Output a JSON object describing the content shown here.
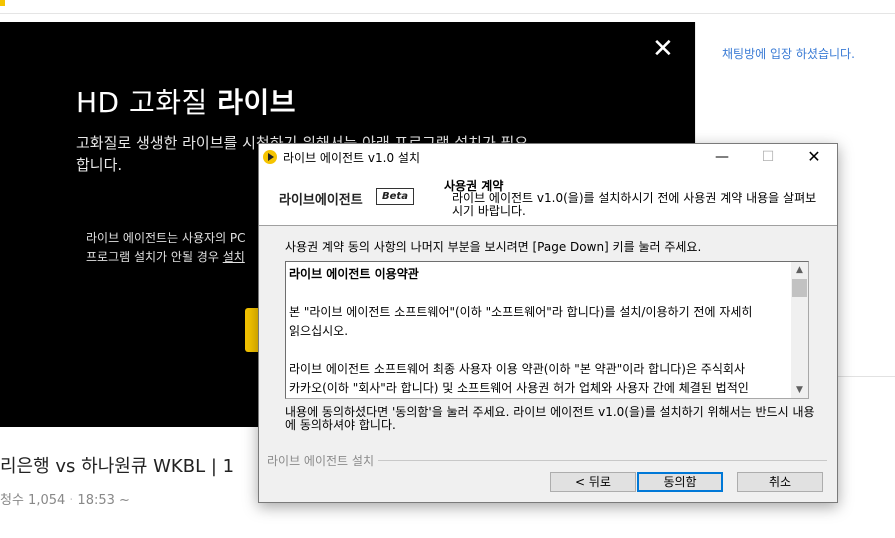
{
  "background": {
    "video": {
      "close_glyph": "✕",
      "title_prefix": "HD 고화질 ",
      "title_bold": "라이브",
      "desc_line1": "고화질로 생생한 라이브를 시청하기 위해서는 아래 프로그램 설치가 필요",
      "desc_line2": "합니다.",
      "note_line1": "라이브 에이전트는 사용자의 PC",
      "note_line2_prefix": "프로그램 설치가 안될 경우 ",
      "note_line2_link": "설치"
    },
    "chat": {
      "message": "채팅방에 입장 하셨습니다."
    },
    "game_title": "리은행 vs 하나원큐 WKBL | 1",
    "meta": {
      "views": "청수 1,054",
      "time": "18:53 ~"
    }
  },
  "dialog": {
    "title": "라이브 에이전트 v1.0 설치",
    "window_controls": {
      "minimize": "—",
      "maximize": "☐",
      "close": "✕"
    },
    "brand": "라이브에이전트",
    "badge": "Beta",
    "header_title": "사용권 계약",
    "header_subtitle": "라이브 에이전트 v1.0(을)를 설치하시기 전에 사용권 계약 내용을 살펴보시기 바랍니다.",
    "instruction": "사용권 계약 동의 사항의 나머지 부분을 보시려면 [Page Down] 키를 눌러 주세요.",
    "license": {
      "heading": "라이브 에이전트 이용약관",
      "para1_line1": "본 \"라이브 에이전트 소프트웨어\"(이하 \"소프트웨어\"라 합니다)를 설치/이용하기 전에 자세히",
      "para1_line2": "읽으십시오.",
      "para2_line1": "라이브 에이전트 소프트웨어 최종 사용자 이용 약관(이하 \"본 약관\"이라 합니다)은 주식회사",
      "para2_line2": "카카오(이하 \"회사\"라 합니다) 및 소프트웨어 사용권 허가 업체와 사용자 간에 체결된 법적인"
    },
    "agree_note": "내용에 동의하셨다면 '동의함'을 눌러 주세요. 라이브 에이전트 v1.0(을)를 설치하기 위해서는 반드시 내용에 동의하셔야 합니다.",
    "footer_label": "라이브 에이전트 설치",
    "buttons": {
      "back": "< 뒤로",
      "agree": "동의함",
      "cancel": "취소"
    }
  },
  "colors": {
    "accent_yellow": "#f5c400",
    "chat_link": "#3a7bd5",
    "focus_blue": "#0078d7"
  }
}
